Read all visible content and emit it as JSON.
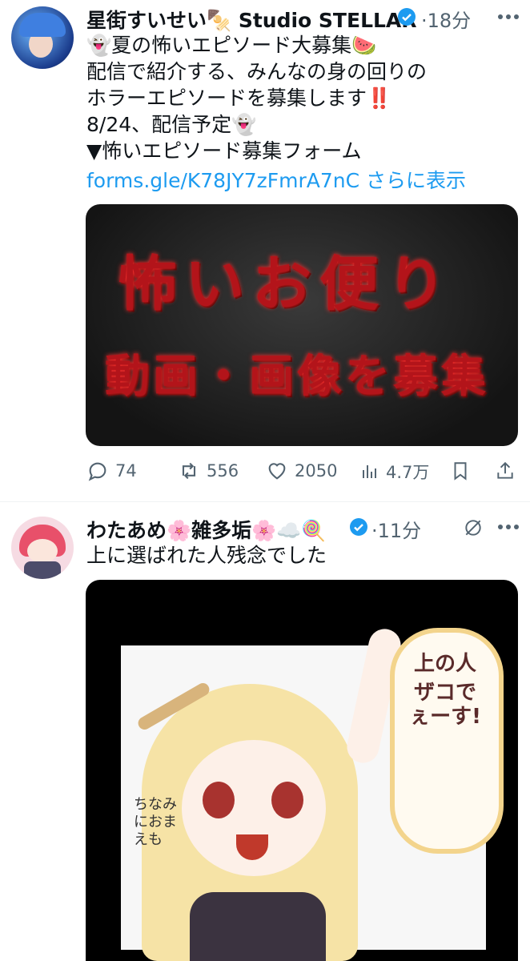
{
  "tweets": [
    {
      "author": "星街すいせい🍢 Studio STELLAR",
      "time": "18分",
      "lines": [
        "👻夏の怖いエピソード大募集🍉",
        "配信で紹介する、みんなの身の回りの",
        "ホラーエピソードを募集します‼️",
        "8/24、配信予定👻",
        "▼怖いエピソード募集フォーム"
      ],
      "link": "forms.gle/K78JY7zFmrA7nC",
      "show_more": "さらに表示",
      "image_text": {
        "line1": "怖いお便り",
        "line2": "動画・画像を募集"
      },
      "stats": {
        "replies": "74",
        "retweets": "556",
        "likes": "2050",
        "views": "4.7万"
      }
    },
    {
      "author": "わたあめ🌸雑多垢🌸☁️🍭",
      "time": "11分",
      "lines": [
        "上に選ばれた人残念でした"
      ],
      "image_text": {
        "bubble1": "上の人",
        "bubble2": "ザコでぇーす!",
        "side": "ちなみにおまえも"
      }
    }
  ],
  "colors": {
    "accent": "#1d9bf0",
    "meta": "#536471",
    "verified": "#1d9bf0"
  }
}
